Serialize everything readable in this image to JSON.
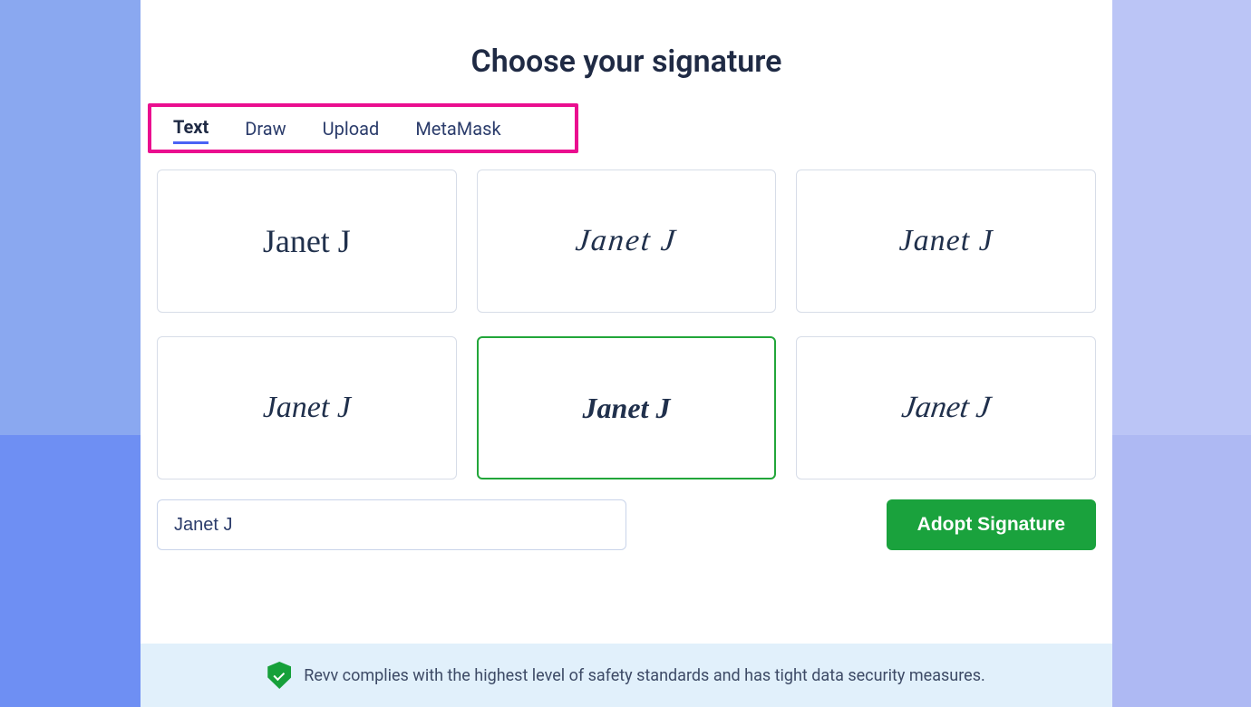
{
  "title": "Choose your signature",
  "tabs": [
    {
      "label": "Text",
      "active": true
    },
    {
      "label": "Draw",
      "active": false
    },
    {
      "label": "Upload",
      "active": false
    },
    {
      "label": "MetaMask",
      "active": false
    }
  ],
  "signature_text": "Janet J",
  "signature_cards": [
    {
      "text": "Janet J",
      "selected": false
    },
    {
      "text": "Janet J",
      "selected": false
    },
    {
      "text": "Janet J",
      "selected": false
    },
    {
      "text": "Janet J",
      "selected": false
    },
    {
      "text": "Janet J",
      "selected": true
    },
    {
      "text": "Janet J",
      "selected": false
    }
  ],
  "name_input_value": "Janet J",
  "adopt_button_label": "Adopt Signature",
  "footer_text": "Revv complies with the highest level of safety standards and has tight data security measures."
}
